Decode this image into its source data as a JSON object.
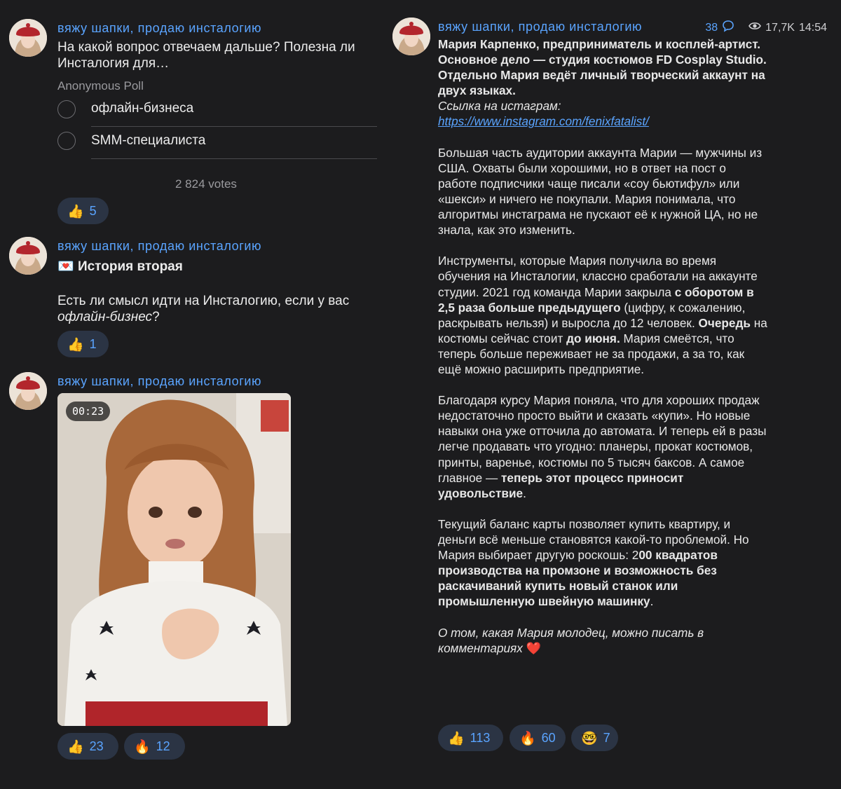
{
  "channel": {
    "name": "вяжу шапки, продаю инсталогию"
  },
  "post1": {
    "question": "На какой вопрос отвечаем дальше? Полезна ли Инсталогия для…",
    "poll_type": "Anonymous Poll",
    "options": [
      "офлайн-бизнеса",
      "SMM-специалиста"
    ],
    "votes": "2 824 votes",
    "reactions": [
      {
        "emoji": "👍",
        "count": "5"
      }
    ]
  },
  "post2": {
    "heading_emoji": "💌",
    "heading": "История вторая",
    "text_before": "Есть ли смысл идти на Инсталогию, если у вас ",
    "text_italic": "офлайн-бизнес",
    "text_after": "?",
    "reactions": [
      {
        "emoji": "👍",
        "count": "1"
      }
    ]
  },
  "post3": {
    "video_duration": "00:23",
    "reactions": [
      {
        "emoji": "👍",
        "count": "23"
      },
      {
        "emoji": "🔥",
        "count": "12"
      }
    ]
  },
  "post4": {
    "comments": "38",
    "views": "17,7K",
    "time": "14:54",
    "bold_intro_1": "Мария Карпенко, предприниматель и косплей-артист.",
    "bold_intro_2": "Основное дело — студия костюмов FD Cosplay Studio. Отдельно Мария ведёт личный творческий аккаунт на двух языках.",
    "link_label": "Ссылка на истаграм: ",
    "link_url": "https://www.instagram.com/fenixfatalist/",
    "p1": "Большая часть аудитории аккаунта Марии — мужчины из США. Охваты были хорошими, но в ответ на пост о работе подписчики чаще писали «соу бьютифул» или «шекси» и ничего не покупали. Мария понимала, что алгоритмы инстаграма не пускают её к нужной ЦА, но не знала, как это изменить.",
    "p2_a": "Инструменты, которые Мария получила во время обучения на Инсталогии, классно сработали на аккаунте студии. 2021 год команда Марии закрыла ",
    "p2_b": "с оборотом в 2,5 раза больше предыдущего",
    "p2_c": " (цифру, к сожалению, раскрывать нельзя) и выросла до 12 человек. ",
    "p2_d": "Очередь",
    "p2_e": " на костюмы сейчас стоит ",
    "p2_f": "до июня.",
    "p2_g": " Мария смеётся, что теперь больше переживает не за продажи, а за то, как ещё можно расширить предприятие.",
    "p3_a": "Благодаря курсу Мария поняла, что для хороших продаж недостаточно просто выйти и сказать «купи». Но новые навыки она уже отточила до автомата. И теперь ей в разы легче продавать что угодно: планеры, прокат костюмов, принты, варенье, костюмы по 5 тысяч баксов. А самое главное — ",
    "p3_b": "теперь этот процесс приносит удовольствие",
    "p3_c": ".",
    "p4_a": "Текущий баланс карты позволяет купить квартиру, и деньги всё меньше становятся какой-то проблемой. Но Мария выбирает другую роскошь: 2",
    "p4_b": "00 квадратов производства на промзоне и возможность без раскачиваний купить новый станок или промышленную швейную машинку",
    "p4_c": ".",
    "p5": "О том, какая Мария молодец, можно писать в комментариях",
    "p5_emoji": "❤️",
    "reactions": [
      {
        "emoji": "👍",
        "count": "113"
      },
      {
        "emoji": "🔥",
        "count": "60"
      },
      {
        "emoji": "🤓",
        "count": "7"
      }
    ]
  }
}
